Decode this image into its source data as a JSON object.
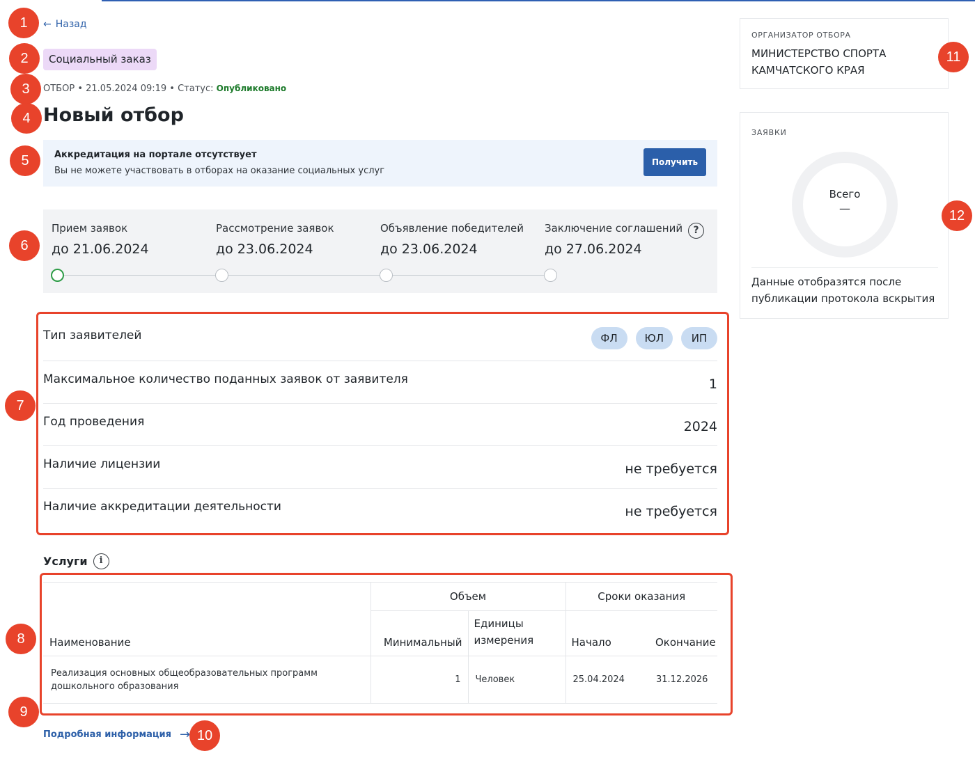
{
  "nav": {
    "back_label": "Назад"
  },
  "tag": {
    "label": "Социальный заказ"
  },
  "meta": {
    "type": "ОТБОР",
    "datetime": "21.05.2024 09:19",
    "status_prefix": "Статус:",
    "status": "Опубликовано",
    "status_color": "#1c7a2a"
  },
  "page": {
    "title": "Новый отбор"
  },
  "alert": {
    "title": "Аккредитация на портале отсутствует",
    "text": "Вы не можете участвовать в отборах на оказание социальных услуг",
    "button_label": "Получить"
  },
  "stages": [
    {
      "label": "Прием заявок",
      "date": "до 21.06.2024",
      "active": true
    },
    {
      "label": "Рассмотрение заявок",
      "date": "до 23.06.2024",
      "active": false
    },
    {
      "label": "Объявление победителей",
      "date": "до 23.06.2024",
      "active": false
    },
    {
      "label": "Заключение соглашений",
      "date": "до 27.06.2024",
      "active": false
    }
  ],
  "stages_help_icon": "question-circle-icon",
  "properties": {
    "applicant_types": {
      "label": "Тип заявителей",
      "chips": [
        "ФЛ",
        "ЮЛ",
        "ИП"
      ]
    },
    "max_applications": {
      "label": "Максимальное количество поданных заявок от заявителя",
      "value": "1"
    },
    "year": {
      "label": "Год проведения",
      "value": "2024"
    },
    "license": {
      "label": "Наличие лицензии",
      "value": "не требуется"
    },
    "accreditation": {
      "label": "Наличие аккредитации деятельности",
      "value": "не требуется"
    }
  },
  "services": {
    "title": "Услуги",
    "info_icon": "info-circle-icon",
    "headers": {
      "name": "Наименование",
      "volume": "Объем",
      "minimum": "Минимальный",
      "units": "Единицы измерения",
      "terms": "Сроки оказания",
      "start": "Начало",
      "end": "Окончание"
    },
    "rows": [
      {
        "name": "Реализация основных общеобразовательных программ дошкольного образования",
        "minimum": "1",
        "units": "Человек",
        "start": "25.04.2024",
        "end": "31.12.2026"
      }
    ]
  },
  "more": {
    "label": "Подробная информация",
    "icon": "arrow-right-icon"
  },
  "organizer": {
    "caption": "ОРГАНИЗАТОР ОТБОРА",
    "name": "МИНИСТЕРСТВО СПОРТА КАМЧАТСКОГО КРАЯ"
  },
  "applications": {
    "caption": "ЗАЯВКИ",
    "total_label": "Всего",
    "total_value": "—",
    "note": "Данные отобразятся после публикации протокола вскрытия"
  },
  "annotations": [
    "1",
    "2",
    "3",
    "4",
    "5",
    "6",
    "7",
    "8",
    "9",
    "10",
    "11",
    "12"
  ],
  "colors": {
    "accent": "#2b5faa",
    "annotation": "#e8432b",
    "tag_bg": "#ecd9f7",
    "chip_bg": "#c9dcf2"
  }
}
